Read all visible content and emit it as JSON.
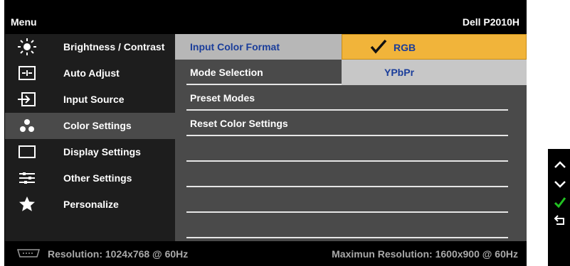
{
  "window": {
    "menu_title": "Menu",
    "model_title": "Dell P2010H"
  },
  "sidebar": {
    "items": [
      {
        "label": "Brightness / Contrast",
        "icon": "brightness-icon",
        "active": false
      },
      {
        "label": "Auto Adjust",
        "icon": "auto-adjust-icon",
        "active": false
      },
      {
        "label": "Input Source",
        "icon": "input-source-icon",
        "active": false
      },
      {
        "label": "Color Settings",
        "icon": "color-settings-icon",
        "active": true
      },
      {
        "label": "Display Settings",
        "icon": "display-settings-icon",
        "active": false
      },
      {
        "label": "Other Settings",
        "icon": "other-settings-icon",
        "active": false
      },
      {
        "label": "Personalize",
        "icon": "star-icon",
        "active": false
      }
    ]
  },
  "panel": {
    "rows": [
      {
        "label": "Input Color Format",
        "selected": true
      },
      {
        "label": "Mode Selection",
        "selected": false
      },
      {
        "label": "Preset Modes",
        "selected": false
      },
      {
        "label": "Reset Color Settings",
        "selected": false
      },
      {
        "label": "",
        "selected": false
      },
      {
        "label": "",
        "selected": false
      },
      {
        "label": "",
        "selected": false
      }
    ],
    "options": {
      "rgb": {
        "label": "RGB",
        "checked": true
      },
      "ypbpr": {
        "label": "YPbPr",
        "checked": false
      }
    }
  },
  "status": {
    "resolution": "Resolution: 1024x768 @ 60Hz",
    "max_resolution": "Maximun Resolution: 1600x900 @ 60Hz",
    "connector_icon": "vga-connector-icon"
  },
  "keys": [
    {
      "name": "up-key",
      "icon": "chevron-up-icon"
    },
    {
      "name": "down-key",
      "icon": "chevron-down-icon"
    },
    {
      "name": "ok-key",
      "icon": "check-icon",
      "color": "#22c122"
    },
    {
      "name": "back-key",
      "icon": "back-arrow-icon"
    }
  ],
  "colors": {
    "highlight_text": "#1a3d9a",
    "rgb_option_bg": "#f1b43a",
    "ypbpr_option_bg": "#c7c7c7",
    "panel_bg": "#4a4a4a",
    "sidebar_bg": "#1d1d1d"
  }
}
